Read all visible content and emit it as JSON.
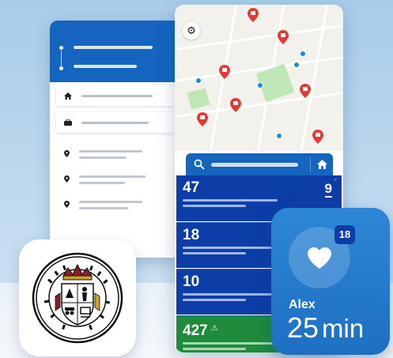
{
  "icons": {
    "settings": "gear-icon",
    "search": "search-icon",
    "home": "home-icon",
    "heart": "heart-icon",
    "pin": "map-pin-icon",
    "bus": "bus-icon"
  },
  "colors": {
    "primary_blue": "#1565c0",
    "dark_blue": "#0d3ea8",
    "green": "#1f8c3c",
    "pin_red": "#e53935",
    "stop_blue": "#1e88e5"
  },
  "arrivals": {
    "routes": [
      {
        "number": "47",
        "time": "9"
      },
      {
        "number": "18"
      },
      {
        "number": "10"
      },
      {
        "number": "427",
        "alert": "⚠"
      }
    ]
  },
  "watch": {
    "badge": "18",
    "name": "Alex",
    "eta_value": "25",
    "eta_unit": "min"
  }
}
